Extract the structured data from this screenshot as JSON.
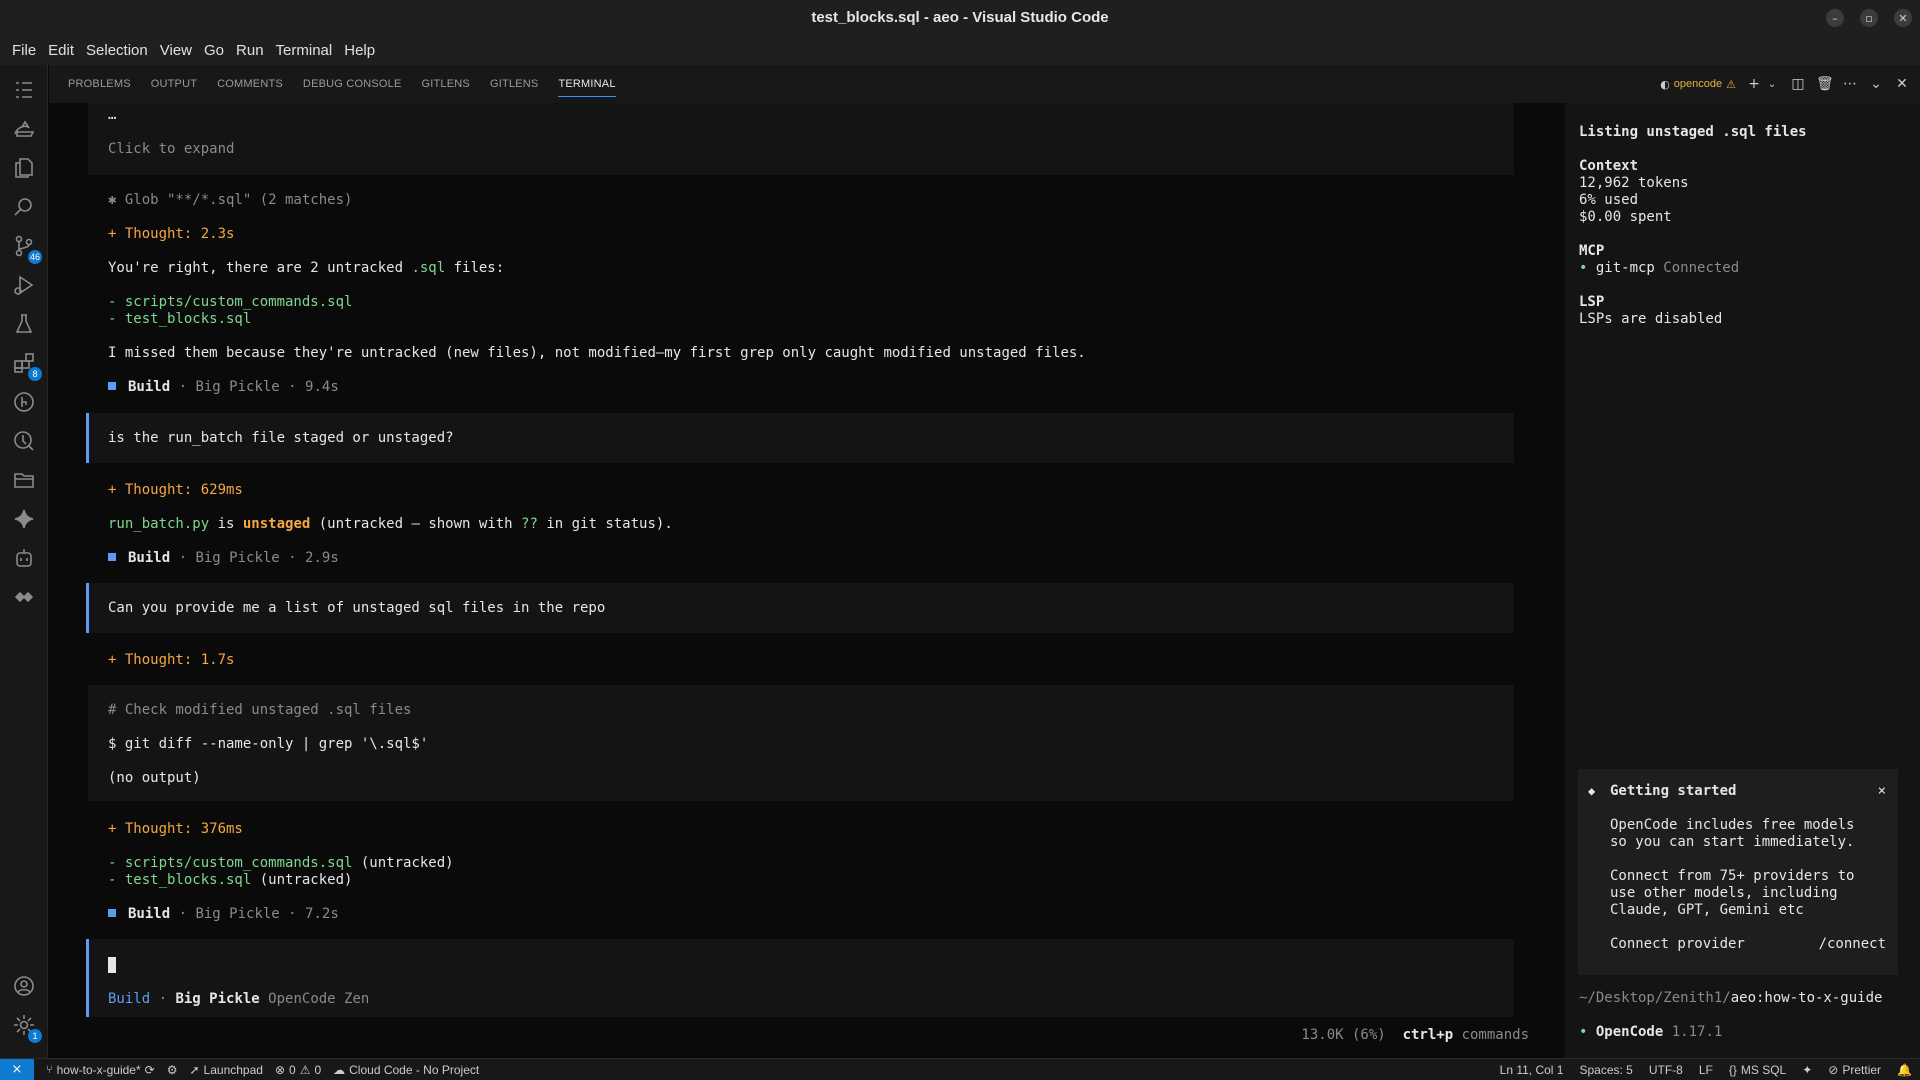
{
  "window": {
    "title": "test_blocks.sql - aeo - Visual Studio Code"
  },
  "menu": [
    "File",
    "Edit",
    "Selection",
    "View",
    "Go",
    "Run",
    "Terminal",
    "Help"
  ],
  "activity_bar": {
    "icons": [
      "explorer-outline-icon",
      "remote-explorer-icon",
      "files-icon",
      "search-icon",
      "source-control-icon",
      "run-debug-icon",
      "testing-icon",
      "extensions-icon",
      "gitlens-icon",
      "git-graph-icon",
      "folder-icon",
      "sparkle-icon",
      "robot-icon",
      "puzzle-icon"
    ],
    "source_control_badge": "46",
    "extensions_badge": "8",
    "settings_badge": "1"
  },
  "panel": {
    "tabs": [
      "PROBLEMS",
      "OUTPUT",
      "COMMENTS",
      "DEBUG CONSOLE",
      "GITLENS",
      "GITLENS",
      "TERMINAL"
    ],
    "active_tab": "TERMINAL",
    "terminal_name": "opencode"
  },
  "chat": {
    "ellipsis": "…",
    "expand": "Click to expand",
    "glob": "✱ Glob \"**/*.sql\" (2 matches)",
    "thought1": "+ Thought: 2.3s",
    "reply1_a": "You're right, there are 2 untracked ",
    "reply1_b": ".sql",
    "reply1_c": " files:",
    "file1": "- scripts/custom_commands.sql",
    "file2": "- test_blocks.sql",
    "reply1_note": "I missed them because they're untracked (new files), not modified—my first grep only caught modified unstaged files.",
    "build_label": "Build",
    "model_label": "· Big Pickle ·",
    "build1_time": "9.4s",
    "user_q1": "is the run_batch file staged or unstaged?",
    "thought2": "+ Thought: 629ms",
    "reply2_file": "run_batch.py",
    "reply2_is": " is ",
    "reply2_unstaged": "unstaged",
    "reply2_mid": " (untracked — shown with ",
    "reply2_qq": "??",
    "reply2_end": " in git status).",
    "build2_time": "2.9s",
    "user_q2": "Can you provide me a list of unstaged sql files in the repo",
    "thought3": "+ Thought: 1.7s",
    "cmd_comment": "# Check modified unstaged .sql files",
    "cmd": "$ git diff --name-only | grep '\\.sql$'",
    "cmd_output": "(no output)",
    "thought4": "+ Thought: 376ms",
    "list1_file": "- scripts/custom_commands.sql",
    "list1_note": " (untracked)",
    "list2_file": "- test_blocks.sql",
    "list2_note": " (untracked)",
    "build3_time": "7.2s",
    "input_mode": "Build",
    "input_sep": " · ",
    "input_model": "Big Pickle",
    "input_provider": " OpenCode Zen",
    "token_usage": "13.0K (6%)",
    "shortcut_key": "ctrl+p",
    "shortcut_label": " commands"
  },
  "sidebar": {
    "title": "Listing unstaged .sql files",
    "context_heading": "Context",
    "tokens": "12,962 tokens",
    "used": "6% used",
    "spent": "$0.00 spent",
    "mcp_heading": "MCP",
    "mcp_bullet": "• ",
    "mcp_name": "git-mcp",
    "mcp_status": " Connected",
    "lsp_heading": "LSP",
    "lsp_status": "LSPs are disabled",
    "getting_started": {
      "title": "Getting started",
      "close": "×",
      "p1_l1": "OpenCode includes free models",
      "p1_l2": "so you can start immediately.",
      "p2_l1": "Connect from 75+ providers to",
      "p2_l2": "use other models, including",
      "p2_l3": "Claude, GPT, Gemini etc",
      "connect_label": "Connect provider",
      "connect_cmd": "/connect"
    },
    "path_prefix": "~/Desktop/Zenith1/",
    "path_suffix": "aeo:how-to-x-guide",
    "version_bullet": "• ",
    "version_name": "OpenCode",
    "version": " 1.17.1"
  },
  "status_bar": {
    "branch": "how-to-x-guide*",
    "launchpad": "Launchpad",
    "errors": "0",
    "warnings": "0",
    "cloud_code": "Cloud Code - No Project",
    "position": "Ln 11, Col 1",
    "spaces": "Spaces: 5",
    "encoding": "UTF-8",
    "eol": "LF",
    "language": "MS SQL",
    "prettier": "Prettier"
  },
  "colors": {
    "accent_blue": "#5c9cf5",
    "thought_orange": "#f5a742",
    "path_green": "#7fd88f",
    "remote_blue": "#0e7ad1"
  }
}
